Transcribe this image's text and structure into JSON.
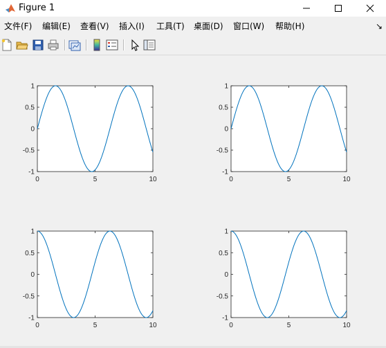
{
  "window": {
    "title": "Figure 1",
    "minimize_icon": "minimize-icon",
    "maximize_icon": "maximize-icon",
    "close_icon": "close-icon"
  },
  "menu": {
    "items": [
      "文件(F)",
      "编辑(E)",
      "查看(V)",
      "插入(I)",
      "工具(T)",
      "桌面(D)",
      "窗口(W)",
      "帮助(H)"
    ],
    "dock_label": "↘"
  },
  "toolbar": {
    "buttons": [
      "new-figure-icon",
      "open-file-icon",
      "save-icon",
      "print-icon",
      "link-plot-icon",
      "colorbar-icon",
      "legend-icon",
      "pointer-icon",
      "property-inspector-icon"
    ]
  },
  "colors": {
    "line": "#0072bd",
    "axes_bg": "#ffffff",
    "figure_bg": "#f0f0f0",
    "axis": "#262626"
  },
  "chart_data": [
    {
      "type": "line",
      "function": "sin(x)",
      "x_range": [
        0,
        10
      ],
      "xlim": [
        0,
        10
      ],
      "ylim": [
        -1,
        1
      ],
      "xticks": [
        "0",
        "5",
        "10"
      ],
      "yticks": [
        "1",
        "0.5",
        "0",
        "-0.5",
        "-1"
      ],
      "grid": false
    },
    {
      "type": "line",
      "function": "sin(x)",
      "x_range": [
        0,
        10
      ],
      "xlim": [
        0,
        10
      ],
      "ylim": [
        -1,
        1
      ],
      "xticks": [
        "0",
        "5",
        "10"
      ],
      "yticks": [
        "1",
        "0.5",
        "0",
        "-0.5",
        "-1"
      ],
      "grid": false
    },
    {
      "type": "line",
      "function": "cos(x)",
      "x_range": [
        0,
        10
      ],
      "xlim": [
        0,
        10
      ],
      "ylim": [
        -1,
        1
      ],
      "xticks": [
        "0",
        "5",
        "10"
      ],
      "yticks": [
        "1",
        "0.5",
        "0",
        "-0.5",
        "-1"
      ],
      "grid": false
    },
    {
      "type": "line",
      "function": "cos(x)",
      "x_range": [
        0,
        10
      ],
      "xlim": [
        0,
        10
      ],
      "ylim": [
        -1,
        1
      ],
      "xticks": [
        "0",
        "5",
        "10"
      ],
      "yticks": [
        "1",
        "0.5",
        "0",
        "-0.5",
        "-1"
      ],
      "grid": false
    }
  ]
}
